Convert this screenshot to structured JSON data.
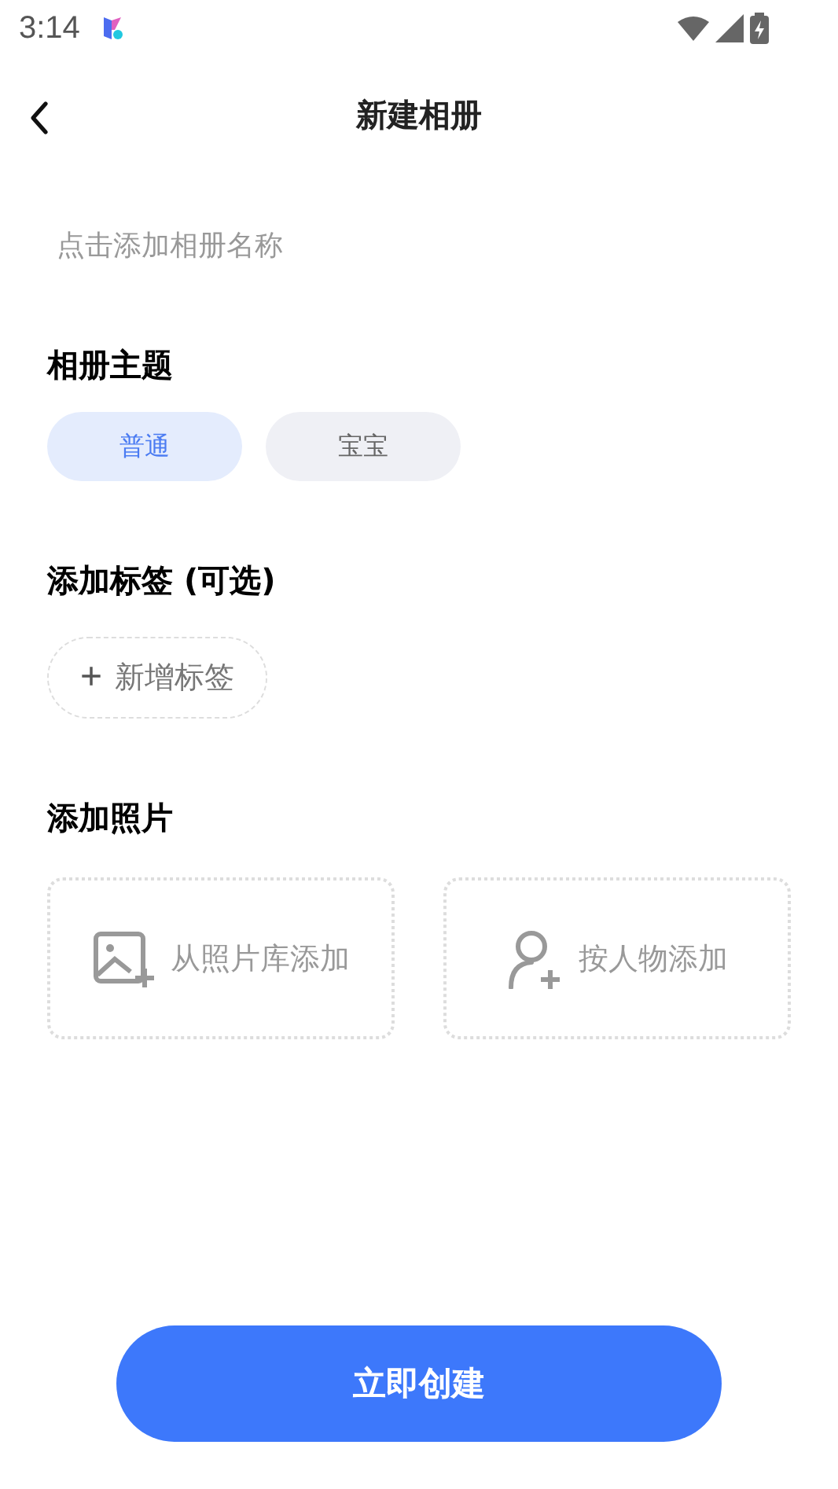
{
  "status_bar": {
    "time": "3:14"
  },
  "header": {
    "title": "新建相册"
  },
  "album_name": {
    "placeholder": "点击添加相册名称"
  },
  "theme_section": {
    "title": "相册主题",
    "options": [
      {
        "label": "普通",
        "selected": true
      },
      {
        "label": "宝宝",
        "selected": false
      }
    ]
  },
  "tag_section": {
    "title": "添加标签 (可选)",
    "add_button": {
      "icon": "+",
      "label": "新增标签"
    }
  },
  "photo_section": {
    "title": "添加照片",
    "options": [
      {
        "kind": "library",
        "label": "从照片库添加"
      },
      {
        "kind": "person",
        "label": "按人物添加"
      }
    ]
  },
  "create_button": {
    "label": "立即创建"
  }
}
